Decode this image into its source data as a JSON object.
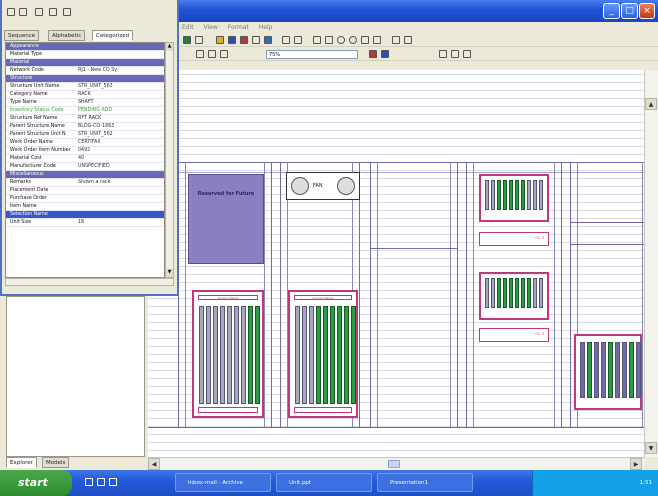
{
  "menu": {
    "items": [
      "Edit",
      "View",
      "Format",
      "Help"
    ]
  },
  "toolbar": {
    "zoom_value": "75%"
  },
  "property_panel": {
    "tabs": [
      "Sequence",
      "Alphabetic",
      "Categorized"
    ],
    "rows": [
      {
        "key": "Appearance",
        "value": "",
        "kind": "cat"
      },
      {
        "key": "Material Type",
        "value": "",
        "kind": ""
      },
      {
        "key": "Material",
        "value": "",
        "kind": "cat"
      },
      {
        "key": "Network Code",
        "value": "RJ1 - New CO Sy",
        "kind": ""
      },
      {
        "key": "Structure",
        "value": "",
        "kind": "cat"
      },
      {
        "key": "Structure Unit Name",
        "value": "STR_UNIT_563",
        "kind": ""
      },
      {
        "key": "Category Name",
        "value": "RACK",
        "kind": ""
      },
      {
        "key": "Type Name",
        "value": "SHAFT",
        "kind": ""
      },
      {
        "key": "Inventory Status Code",
        "value": "PENDING ADD",
        "kind": "green"
      },
      {
        "key": "Structure Ref Name",
        "value": "RFT RACK",
        "kind": ""
      },
      {
        "key": "Parent Structure Name",
        "value": "BLDG-CO-1863",
        "kind": ""
      },
      {
        "key": "Parent Structure Unit N",
        "value": "STR_UNIT_562",
        "kind": ""
      },
      {
        "key": "Work Order Name",
        "value": "CERTIFAX",
        "kind": ""
      },
      {
        "key": "Work Order Item Number",
        "value": "0492",
        "kind": ""
      },
      {
        "key": "Material Cost",
        "value": "40",
        "kind": ""
      },
      {
        "key": "Manufacturer Code",
        "value": "UNSPECIFIED",
        "kind": ""
      },
      {
        "key": "Miscellaneous",
        "value": "",
        "kind": "cat"
      },
      {
        "key": "Remarks",
        "value": "Shown a rack",
        "kind": ""
      },
      {
        "key": "Placement Date",
        "value": "",
        "kind": ""
      },
      {
        "key": "Purchase Order",
        "value": "",
        "kind": ""
      },
      {
        "key": "Item Name",
        "value": "",
        "kind": ""
      },
      {
        "key": "Selection Name",
        "value": "",
        "kind": "sel"
      },
      {
        "key": "Unit Size",
        "value": "18",
        "kind": ""
      }
    ]
  },
  "left_tabs": [
    "Explorer",
    "Models"
  ],
  "canvas": {
    "reserved_label": "Reserved for Future",
    "fan_label": "FAN",
    "card_label": "Jumper Matrix",
    "small_card_label": "OC-3"
  },
  "taskbar": {
    "start_label": "start",
    "buttons": [
      "Inbox-mail - Archive",
      "Unit.ppt",
      "Presentation1"
    ],
    "clock": "1:51"
  },
  "colors": {
    "accent": "#2a4fb8",
    "rack_line": "#6e6aa8",
    "card_border": "#c0387b",
    "slot_green": "#2a9c44",
    "reserved_fill": "#8a7fbf"
  }
}
